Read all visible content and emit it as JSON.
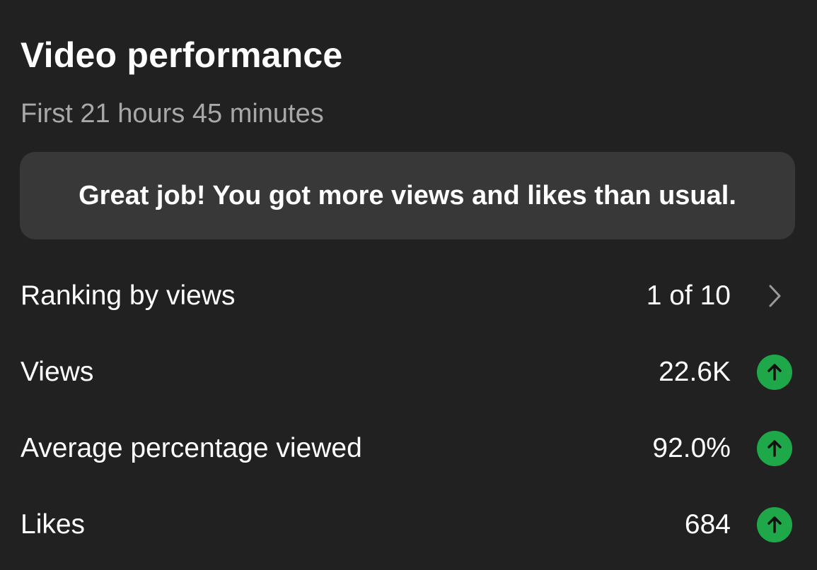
{
  "header": {
    "title": "Video performance",
    "subtitle": "First 21 hours 45 minutes"
  },
  "banner": {
    "text": "Great job! You got more views and likes than usual."
  },
  "metrics": [
    {
      "label": "Ranking by views",
      "value": "1 of 10",
      "icon": "chevron-right-icon"
    },
    {
      "label": "Views",
      "value": "22.6K",
      "icon": "arrow-up-icon"
    },
    {
      "label": "Average percentage viewed",
      "value": "92.0%",
      "icon": "arrow-up-icon"
    },
    {
      "label": "Likes",
      "value": "684",
      "icon": "arrow-up-icon"
    }
  ],
  "colors": {
    "background": "#212121",
    "card": "#383838",
    "subtitle": "#a8a8a8",
    "trend_up": "#1fa84a"
  }
}
